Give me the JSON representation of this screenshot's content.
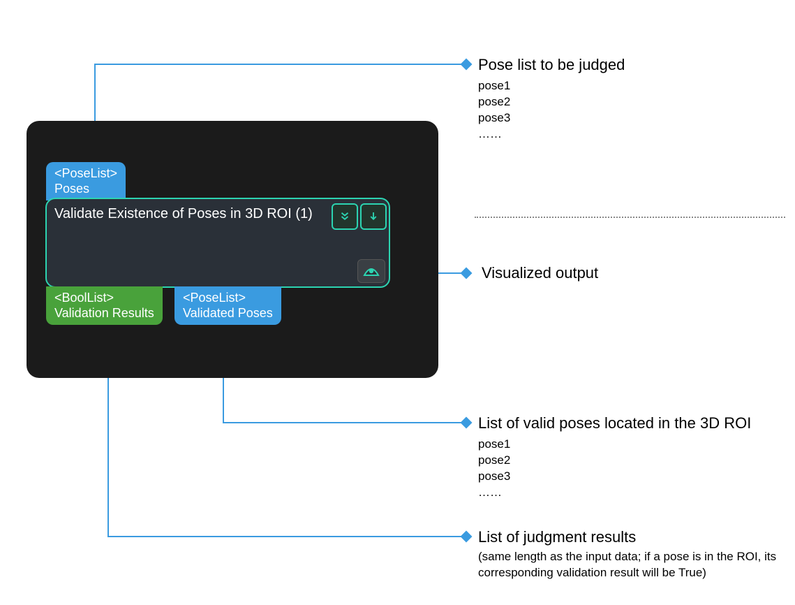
{
  "node": {
    "title": "Validate Existence of Poses in 3D ROI (1)",
    "input_port": {
      "type": "<PoseList>",
      "name": "Poses"
    },
    "output_port_bool": {
      "type": "<BoolList>",
      "name": "Validation Results"
    },
    "output_port_pose": {
      "type": "<PoseList>",
      "name": "Validated Poses"
    }
  },
  "annotations": {
    "input": {
      "title": "Pose list to be judged",
      "items": [
        "pose1",
        "pose2",
        "pose3",
        "……"
      ]
    },
    "visualized": {
      "title": "Visualized output"
    },
    "valid_poses": {
      "title": "List of valid poses located in the 3D ROI",
      "items": [
        "pose1",
        "pose2",
        "pose3",
        "……"
      ]
    },
    "judgment": {
      "title": "List of judgment results",
      "note": "(same length as the input data; if a pose is in the ROI, its corresponding validation result will be True)"
    }
  },
  "colors": {
    "line": "#3a9be0",
    "teal": "#2cd4b1",
    "blue_port": "#3a9be0",
    "green_port": "#49a23b"
  }
}
